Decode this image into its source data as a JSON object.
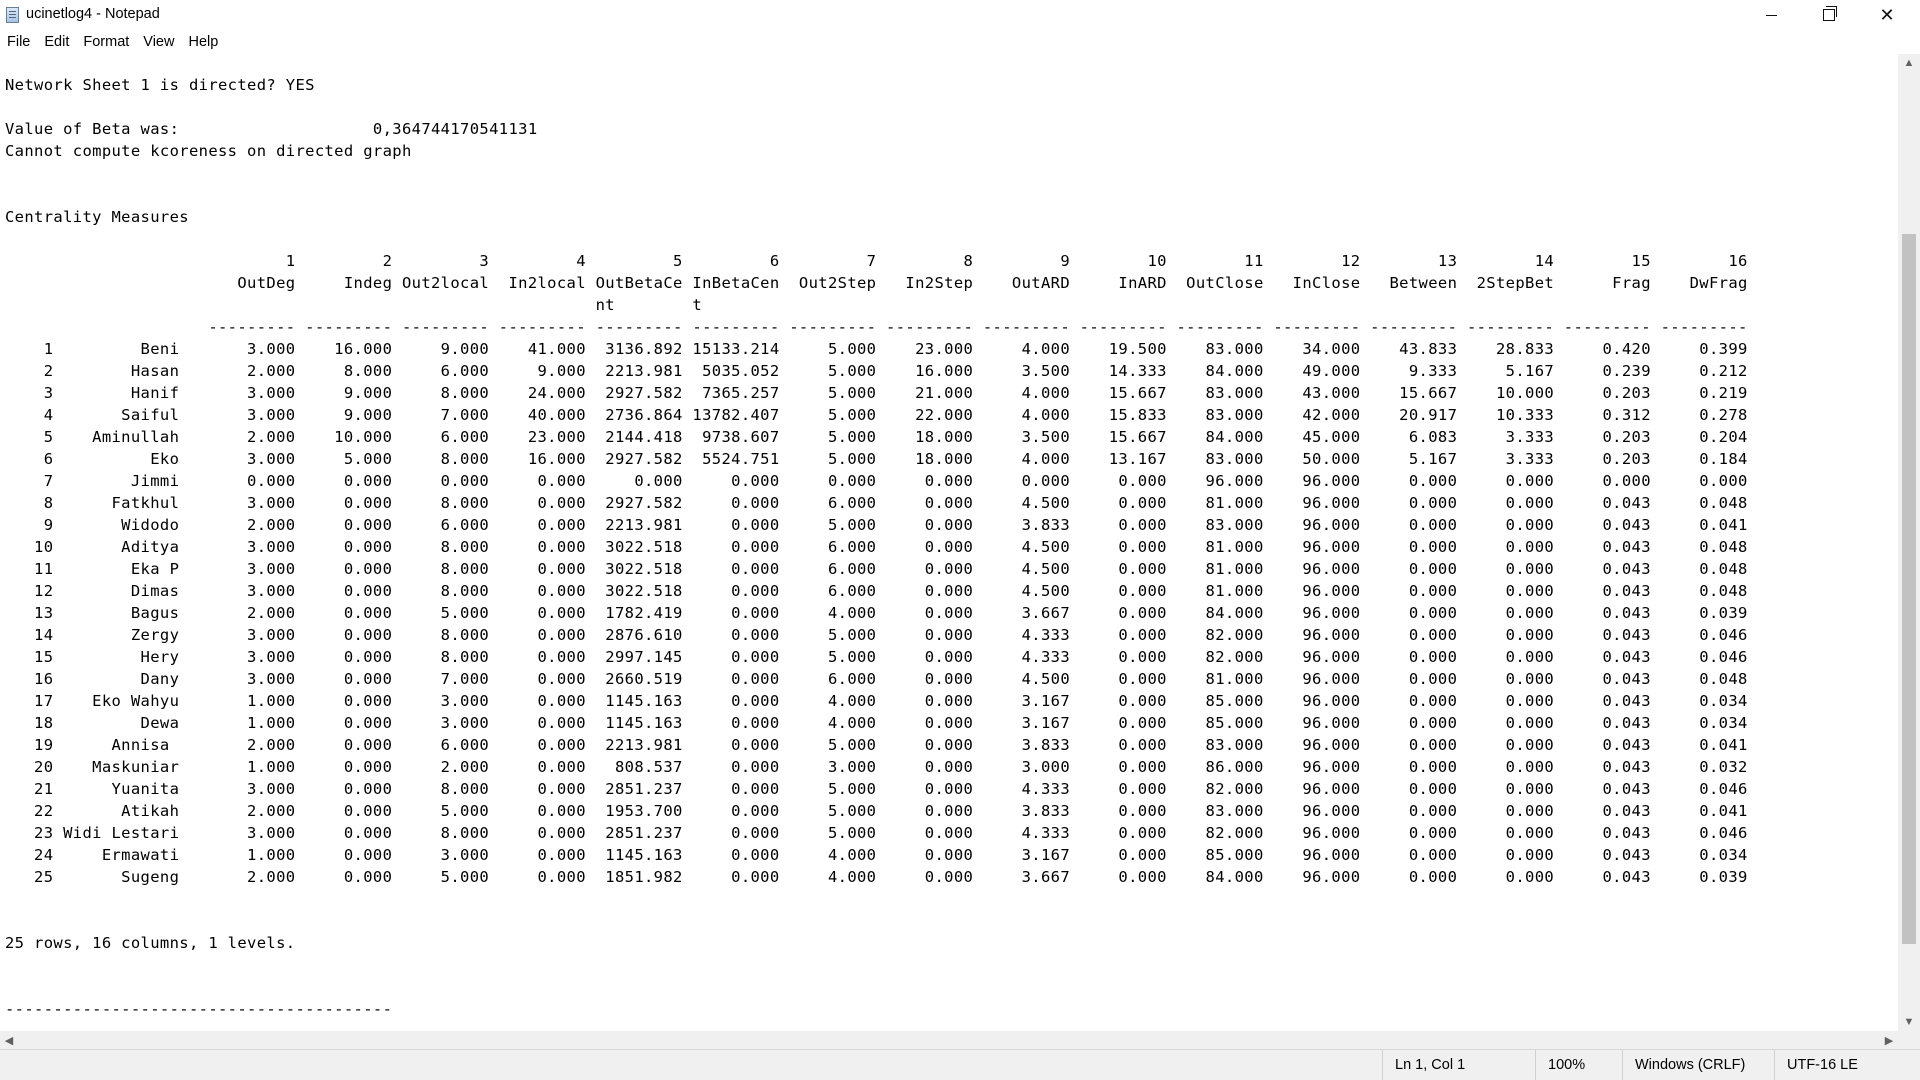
{
  "window": {
    "title": "ucinetlog4 - Notepad",
    "controls": [
      "minimize",
      "maximize",
      "close"
    ]
  },
  "menu": {
    "items": [
      "File",
      "Edit",
      "Format",
      "View",
      "Help"
    ]
  },
  "document": {
    "lines": [
      "Network Sheet 1 is directed? YES",
      "",
      "Value of Beta was:                    0,364744170541131",
      "Cannot compute kcoreness on directed graph",
      "",
      "",
      "Centrality Measures",
      "",
      "                             1         2         3         4         5         6         7         8         9        10        11        12        13        14        15        16",
      "                        OutDeg     Indeg Out2local  In2local OutBetaCe InBetaCen  Out2Step   In2Step    OutARD     InARD  OutClose   InClose   Between  2StepBet      Frag    DwFrag",
      "                                                             nt        t",
      "                     --------- --------- --------- --------- --------- --------- --------- --------- --------- --------- --------- --------- --------- --------- --------- ---------",
      "    1         Beni       3.000    16.000     9.000    41.000  3136.892 15133.214     5.000    23.000     4.000    19.500    83.000    34.000    43.833    28.833     0.420     0.399",
      "    2        Hasan       2.000     8.000     6.000     9.000  2213.981  5035.052     5.000    16.000     3.500    14.333    84.000    49.000     9.333     5.167     0.239     0.212",
      "    3        Hanif       3.000     9.000     8.000    24.000  2927.582  7365.257     5.000    21.000     4.000    15.667    83.000    43.000    15.667    10.000     0.203     0.219",
      "    4       Saiful       3.000     9.000     7.000    40.000  2736.864 13782.407     5.000    22.000     4.000    15.833    83.000    42.000    20.917    10.333     0.312     0.278",
      "    5    Aminullah       2.000    10.000     6.000    23.000  2144.418  9738.607     5.000    18.000     3.500    15.667    84.000    45.000     6.083     3.333     0.203     0.204",
      "    6          Eko       3.000     5.000     8.000    16.000  2927.582  5524.751     5.000    18.000     4.000    13.167    83.000    50.000     5.167     3.333     0.203     0.184",
      "    7        Jimmi       0.000     0.000     0.000     0.000     0.000     0.000     0.000     0.000     0.000     0.000    96.000    96.000     0.000     0.000     0.000     0.000",
      "    8      Fatkhul       3.000     0.000     8.000     0.000  2927.582     0.000     6.000     0.000     4.500     0.000    81.000    96.000     0.000     0.000     0.043     0.048",
      "    9       Widodo       2.000     0.000     6.000     0.000  2213.981     0.000     5.000     0.000     3.833     0.000    83.000    96.000     0.000     0.000     0.043     0.041",
      "   10       Aditya       3.000     0.000     8.000     0.000  3022.518     0.000     6.000     0.000     4.500     0.000    81.000    96.000     0.000     0.000     0.043     0.048",
      "   11        Eka P       3.000     0.000     8.000     0.000  3022.518     0.000     6.000     0.000     4.500     0.000    81.000    96.000     0.000     0.000     0.043     0.048",
      "   12        Dimas       3.000     0.000     8.000     0.000  3022.518     0.000     6.000     0.000     4.500     0.000    81.000    96.000     0.000     0.000     0.043     0.048",
      "   13        Bagus       2.000     0.000     5.000     0.000  1782.419     0.000     4.000     0.000     3.667     0.000    84.000    96.000     0.000     0.000     0.043     0.039",
      "   14        Zergy       3.000     0.000     8.000     0.000  2876.610     0.000     5.000     0.000     4.333     0.000    82.000    96.000     0.000     0.000     0.043     0.046",
      "   15         Hery       3.000     0.000     8.000     0.000  2997.145     0.000     5.000     0.000     4.333     0.000    82.000    96.000     0.000     0.000     0.043     0.046",
      "   16         Dany       3.000     0.000     7.000     0.000  2660.519     0.000     6.000     0.000     4.500     0.000    81.000    96.000     0.000     0.000     0.043     0.048",
      "   17    Eko Wahyu       1.000     0.000     3.000     0.000  1145.163     0.000     4.000     0.000     3.167     0.000    85.000    96.000     0.000     0.000     0.043     0.034",
      "   18         Dewa       1.000     0.000     3.000     0.000  1145.163     0.000     4.000     0.000     3.167     0.000    85.000    96.000     0.000     0.000     0.043     0.034",
      "   19      Annisa        2.000     0.000     6.000     0.000  2213.981     0.000     5.000     0.000     3.833     0.000    83.000    96.000     0.000     0.000     0.043     0.041",
      "   20    Maskuniar       1.000     0.000     2.000     0.000   808.537     0.000     3.000     0.000     3.000     0.000    86.000    96.000     0.000     0.000     0.043     0.032",
      "   21      Yuanita       3.000     0.000     8.000     0.000  2851.237     0.000     5.000     0.000     4.333     0.000    82.000    96.000     0.000     0.000     0.043     0.046",
      "   22       Atikah       2.000     0.000     5.000     0.000  1953.700     0.000     5.000     0.000     3.833     0.000    83.000    96.000     0.000     0.000     0.043     0.041",
      "   23 Widi Lestari       3.000     0.000     8.000     0.000  2851.237     0.000     5.000     0.000     4.333     0.000    82.000    96.000     0.000     0.000     0.043     0.046",
      "   24     Ermawati       1.000     0.000     3.000     0.000  1145.163     0.000     4.000     0.000     3.167     0.000    85.000    96.000     0.000     0.000     0.043     0.034",
      "   25       Sugeng       2.000     0.000     5.000     0.000  1851.982     0.000     4.000     0.000     3.667     0.000    84.000    96.000     0.000     0.000     0.043     0.039",
      "",
      "",
      "25 rows, 16 columns, 1 levels.",
      "",
      "",
      "----------------------------------------"
    ]
  },
  "statusbar": {
    "position": "Ln 1, Col 1",
    "zoom": "100%",
    "line_ending": "Windows (CRLF)",
    "encoding": "UTF-16 LE"
  }
}
